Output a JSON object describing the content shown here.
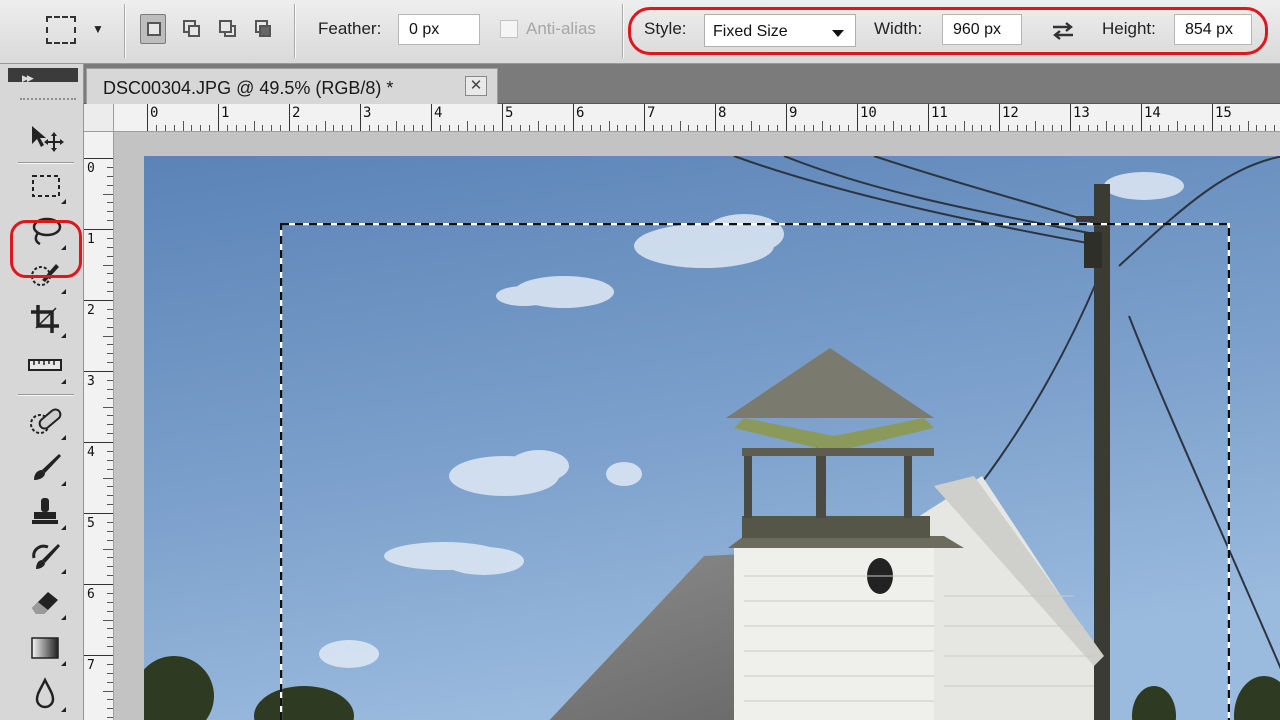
{
  "options_bar": {
    "feather_label": "Feather:",
    "feather_value": "0 px",
    "antialias_label": "Anti-alias",
    "style_label": "Style:",
    "style_value": "Fixed Size",
    "width_label": "Width:",
    "width_value": "960 px",
    "height_label": "Height:",
    "height_value": "854 px"
  },
  "document": {
    "tab_title": "DSC00304.JPG @ 49.5% (RGB/8) *",
    "close_glyph": "✕"
  },
  "rulers": {
    "horizontal_labels": [
      "0",
      "1",
      "2",
      "3",
      "4",
      "5",
      "6",
      "7",
      "8",
      "9",
      "10",
      "11",
      "12",
      "13",
      "14",
      "15"
    ],
    "vertical_labels": [
      "0",
      "1",
      "2",
      "3",
      "4",
      "5",
      "6",
      "7"
    ]
  },
  "tools": [
    {
      "name": "move-tool",
      "icon": "move-icon"
    },
    {
      "name": "rectangular-marquee-tool",
      "icon": "marquee-icon",
      "active": true
    },
    {
      "name": "lasso-tool",
      "icon": "lasso-icon"
    },
    {
      "name": "quick-selection-tool",
      "icon": "quick-selection-icon"
    },
    {
      "name": "crop-tool",
      "icon": "crop-icon"
    },
    {
      "name": "ruler-tool",
      "icon": "ruler-icon"
    },
    {
      "name": "healing-brush-tool",
      "icon": "bandage-icon"
    },
    {
      "name": "brush-tool",
      "icon": "brush-icon"
    },
    {
      "name": "clone-stamp-tool",
      "icon": "stamp-icon"
    },
    {
      "name": "history-brush-tool",
      "icon": "history-brush-icon"
    },
    {
      "name": "eraser-tool",
      "icon": "eraser-icon"
    },
    {
      "name": "gradient-tool",
      "icon": "gradient-icon"
    },
    {
      "name": "blur-tool",
      "icon": "droplet-icon"
    }
  ],
  "colors": {
    "highlight": "#e0161e",
    "sky_top": "#5f87b8",
    "sky_bottom": "#8eb0d6"
  }
}
